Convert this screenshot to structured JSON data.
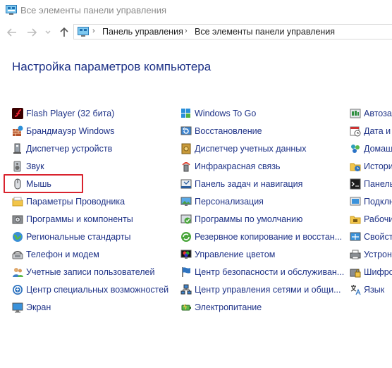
{
  "window": {
    "title": "Все элементы панели управления"
  },
  "address": {
    "crumbs": [
      "Панель управления",
      "Все элементы панели управления"
    ]
  },
  "heading": "Настройка параметров компьютера",
  "columns": [
    {
      "items": [
        {
          "label": "Flash Player (32 бита)",
          "icon": "flash-icon"
        },
        {
          "label": "Брандмауэр Windows",
          "icon": "firewall-icon"
        },
        {
          "label": "Диспетчер устройств",
          "icon": "device-manager-icon"
        },
        {
          "label": "Звук",
          "icon": "speaker-icon"
        },
        {
          "label": "Мышь",
          "icon": "mouse-icon"
        },
        {
          "label": "Параметры Проводника",
          "icon": "folder-options-icon"
        },
        {
          "label": "Программы и компоненты",
          "icon": "programs-icon"
        },
        {
          "label": "Региональные стандарты",
          "icon": "region-icon"
        },
        {
          "label": "Телефон и модем",
          "icon": "phone-modem-icon"
        },
        {
          "label": "Учетные записи пользователей",
          "icon": "user-accounts-icon"
        },
        {
          "label": "Центр специальных возможностей",
          "icon": "accessibility-icon"
        },
        {
          "label": "Экран",
          "icon": "display-icon"
        }
      ]
    },
    {
      "items": [
        {
          "label": "Windows To Go",
          "icon": "windows-to-go-icon"
        },
        {
          "label": "Восстановление",
          "icon": "recovery-icon"
        },
        {
          "label": "Диспетчер учетных данных",
          "icon": "credential-manager-icon"
        },
        {
          "label": "Инфракрасная связь",
          "icon": "infrared-icon"
        },
        {
          "label": "Панель задач и навигация",
          "icon": "taskbar-icon"
        },
        {
          "label": "Персонализация",
          "icon": "personalization-icon"
        },
        {
          "label": "Программы по умолчанию",
          "icon": "default-programs-icon"
        },
        {
          "label": "Резервное копирование и восстан...",
          "icon": "backup-icon"
        },
        {
          "label": "Управление цветом",
          "icon": "color-management-icon"
        },
        {
          "label": "Центр безопасности и обслуживан...",
          "icon": "security-center-icon"
        },
        {
          "label": "Центр управления сетями и общи...",
          "icon": "network-center-icon"
        },
        {
          "label": "Электропитание",
          "icon": "power-icon"
        }
      ]
    },
    {
      "items": [
        {
          "label": "Автоза",
          "icon": "autoplay-icon"
        },
        {
          "label": "Дата и в",
          "icon": "date-time-icon"
        },
        {
          "label": "Домаш",
          "icon": "homegroup-icon"
        },
        {
          "label": "Истори",
          "icon": "file-history-icon"
        },
        {
          "label": "Панель",
          "icon": "panel-icon"
        },
        {
          "label": "Подклн",
          "icon": "remote-apps-icon"
        },
        {
          "label": "Рабочи",
          "icon": "work-folders-icon"
        },
        {
          "label": "Свойст",
          "icon": "properties-icon"
        },
        {
          "label": "Устрон",
          "icon": "devices-icon"
        },
        {
          "label": "Шифро",
          "icon": "encryption-icon"
        },
        {
          "label": "Язык",
          "icon": "language-icon"
        }
      ]
    }
  ],
  "highlighted_item": "Мышь"
}
